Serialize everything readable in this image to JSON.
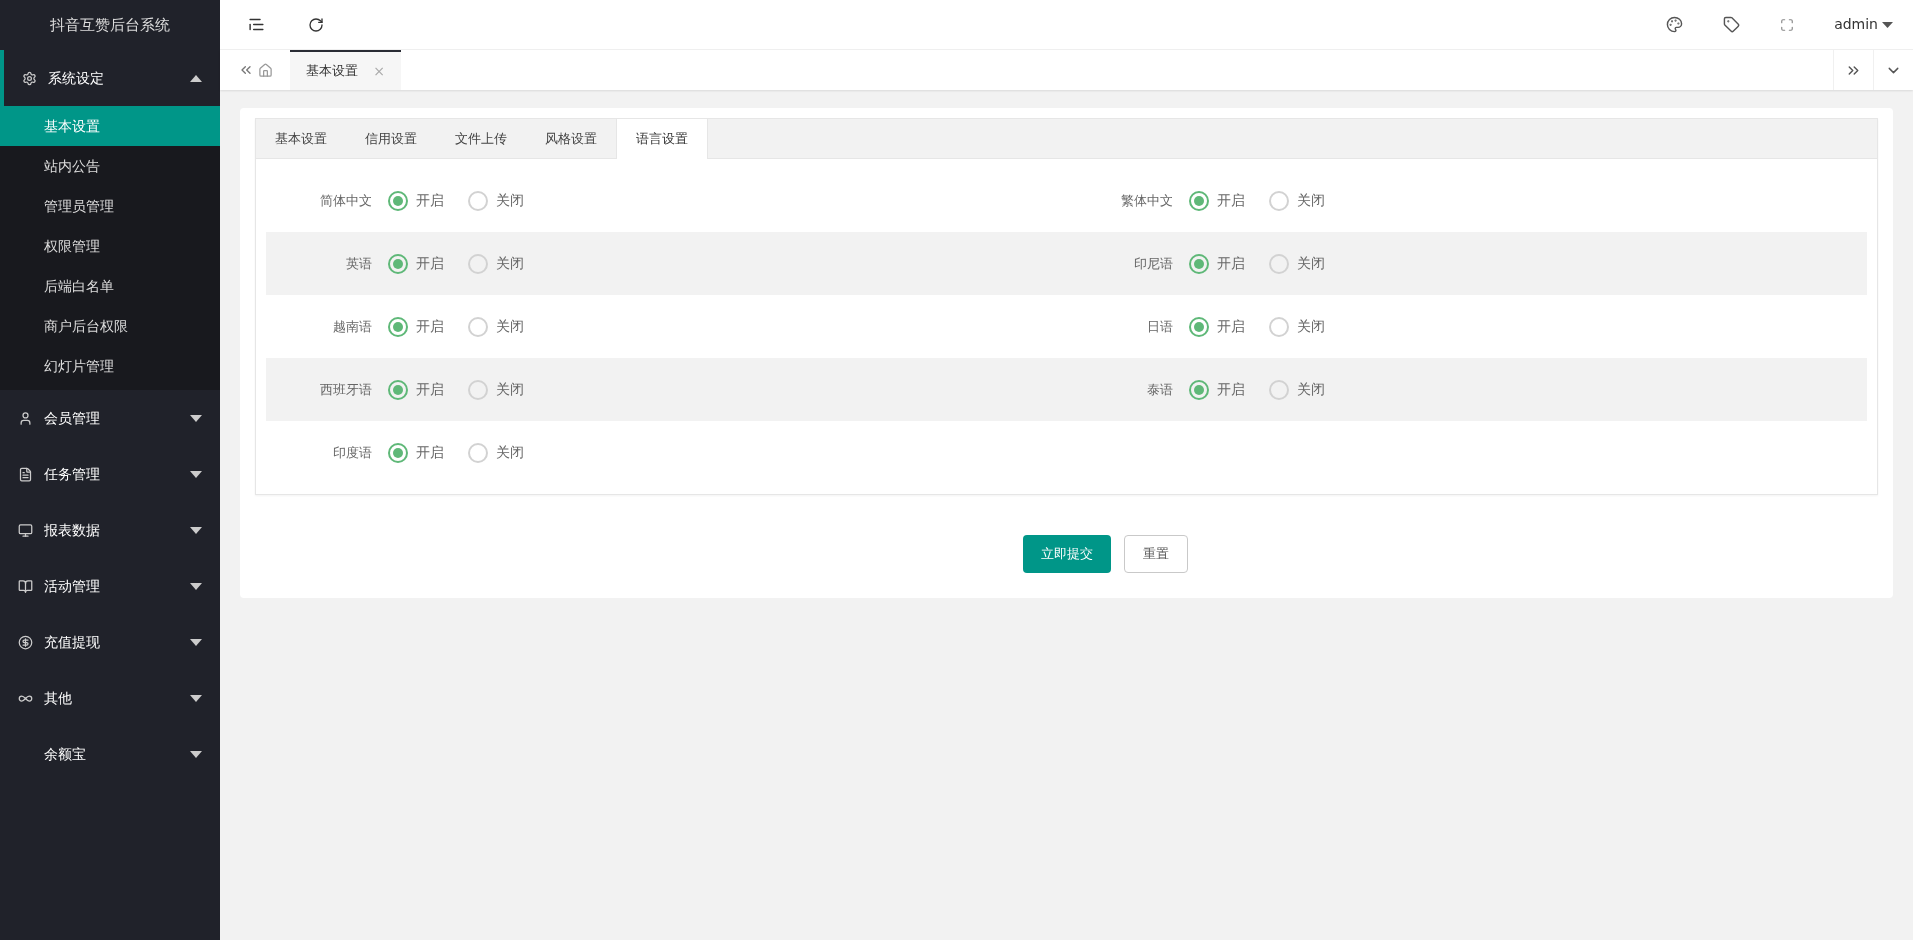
{
  "sidebar": {
    "title": "抖音互赞后台系统",
    "groups": [
      {
        "label": "系统设定",
        "expanded": true,
        "children": [
          {
            "label": "基本设置",
            "selected": true
          },
          {
            "label": "站内公告",
            "selected": false
          },
          {
            "label": "管理员管理",
            "selected": false
          },
          {
            "label": "权限管理",
            "selected": false
          },
          {
            "label": "后端白名单",
            "selected": false
          },
          {
            "label": "商户后台权限",
            "selected": false
          },
          {
            "label": "幻灯片管理",
            "selected": false
          }
        ]
      },
      {
        "label": "会员管理",
        "expanded": false
      },
      {
        "label": "任务管理",
        "expanded": false
      },
      {
        "label": "报表数据",
        "expanded": false
      },
      {
        "label": "活动管理",
        "expanded": false
      },
      {
        "label": "充值提现",
        "expanded": false
      },
      {
        "label": "其他",
        "expanded": false
      },
      {
        "label": "余额宝",
        "expanded": false
      }
    ]
  },
  "header": {
    "user": "admin"
  },
  "page_tabs": [
    {
      "label": "基本设置",
      "selected": true,
      "close": "×"
    }
  ],
  "form_tabs": [
    {
      "label": "基本设置",
      "selected": false
    },
    {
      "label": "信用设置",
      "selected": false
    },
    {
      "label": "文件上传",
      "selected": false
    },
    {
      "label": "风格设置",
      "selected": false
    },
    {
      "label": "语言设置",
      "selected": true
    }
  ],
  "rows": [
    [
      {
        "label": "简体中文",
        "options": [
          {
            "label": "开启",
            "selected": true
          },
          {
            "label": "关闭",
            "selected": false
          }
        ]
      },
      {
        "label": "繁体中文",
        "options": [
          {
            "label": "开启",
            "selected": true
          },
          {
            "label": "关闭",
            "selected": false
          }
        ]
      }
    ],
    [
      {
        "label": "英语",
        "options": [
          {
            "label": "开启",
            "selected": true
          },
          {
            "label": "关闭",
            "selected": false
          }
        ]
      },
      {
        "label": "印尼语",
        "options": [
          {
            "label": "开启",
            "selected": true
          },
          {
            "label": "关闭",
            "selected": false
          }
        ]
      }
    ],
    [
      {
        "label": "越南语",
        "options": [
          {
            "label": "开启",
            "selected": true
          },
          {
            "label": "关闭",
            "selected": false
          }
        ]
      },
      {
        "label": "日语",
        "options": [
          {
            "label": "开启",
            "selected": true
          },
          {
            "label": "关闭",
            "selected": false
          }
        ]
      }
    ],
    [
      {
        "label": "西班牙语",
        "options": [
          {
            "label": "开启",
            "selected": true
          },
          {
            "label": "关闭",
            "selected": false
          }
        ]
      },
      {
        "label": "泰语",
        "options": [
          {
            "label": "开启",
            "selected": true
          },
          {
            "label": "关闭",
            "selected": false
          }
        ]
      }
    ],
    [
      {
        "label": "印度语",
        "options": [
          {
            "label": "开启",
            "selected": true
          },
          {
            "label": "关闭",
            "selected": false
          }
        ]
      }
    ]
  ],
  "buttons": {
    "submit": "立即提交",
    "reset": "重置"
  }
}
